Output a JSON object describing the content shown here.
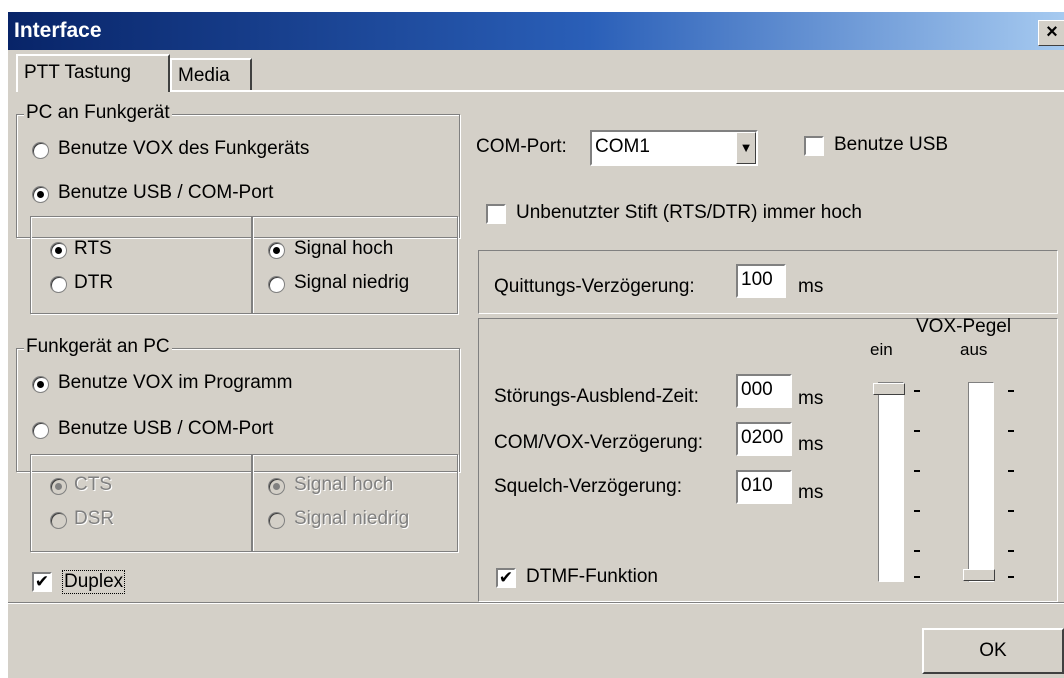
{
  "window": {
    "title": "Interface",
    "close_glyph": "×"
  },
  "tabs": [
    {
      "label": "PTT Tastung",
      "active": true
    },
    {
      "label": "Media",
      "active": false
    }
  ],
  "pc_to_radio": {
    "legend": "PC an Funkgerät",
    "options": [
      "Benutze VOX des Funkgeräts",
      "Benutze USB / COM-Port"
    ],
    "selected": 1,
    "line": {
      "options": [
        "RTS",
        "DTR"
      ],
      "selected": 0
    },
    "signal": {
      "options": [
        "Signal hoch",
        "Signal niedrig"
      ],
      "selected": 0
    }
  },
  "radio_to_pc": {
    "legend": "Funkgerät an PC",
    "options": [
      "Benutze VOX im Programm",
      "Benutze USB / COM-Port"
    ],
    "selected": 0,
    "line": {
      "options": [
        "CTS",
        "DSR"
      ],
      "selected": 0,
      "disabled": true
    },
    "signal": {
      "options": [
        "Signal hoch",
        "Signal niedrig"
      ],
      "selected": 0,
      "disabled": true
    }
  },
  "duplex": {
    "label": "Duplex",
    "checked": true
  },
  "com": {
    "label": "COM-Port:",
    "value": "COM1",
    "use_usb": {
      "label": "Benutze USB",
      "checked": false
    },
    "unused_pin": {
      "label": "Unbenutzter Stift (RTS/DTR) immer hoch",
      "checked": false
    }
  },
  "ack_delay": {
    "label": "Quittungs-Verzögerung:",
    "value": "100",
    "unit": "ms"
  },
  "timing": {
    "noise_blank": {
      "label": "Störungs-Ausblend-Zeit:",
      "value": "000",
      "unit": "ms"
    },
    "com_vox_delay": {
      "label": "COM/VOX-Verzögerung:",
      "value": "0200",
      "unit": "ms"
    },
    "squelch_delay": {
      "label": "Squelch-Verzögerung:",
      "value": "010",
      "unit": "ms"
    }
  },
  "dtmf": {
    "label": "DTMF-Funktion",
    "checked": true
  },
  "vox_level": {
    "title": "VOX-Pegel",
    "on_label": "ein",
    "off_label": "aus",
    "on_level": 1.0,
    "off_level": 0.0
  },
  "ok_label": "OK",
  "check_glyph": "✔"
}
